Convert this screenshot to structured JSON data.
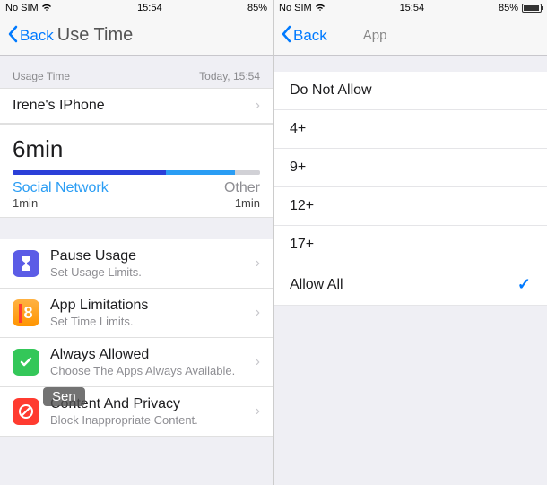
{
  "left": {
    "status": {
      "carrier": "No SIM",
      "time": "15:54",
      "battery": "85%"
    },
    "nav": {
      "back": "Back",
      "title": "Use Time"
    },
    "section": {
      "label": "Usage Time",
      "timestamp": "Today, 15:54"
    },
    "device": {
      "name": "Irene's IPhone"
    },
    "usage": {
      "total": "6min",
      "cat1_label": "Social Network",
      "cat2_label": "Other",
      "cat1_time": "1min",
      "cat2_time": "1min"
    },
    "overlay": "Sen",
    "menu": [
      {
        "title": "Pause Usage",
        "sub": "Set Usage Limits."
      },
      {
        "title": "App Limitations",
        "sub": "Set Time Limits."
      },
      {
        "title": "Always Allowed",
        "sub": "Choose The Apps Always Available."
      },
      {
        "title": "Content And Privacy",
        "sub": "Block Inappropriate Content."
      }
    ],
    "icon_num": "8"
  },
  "right": {
    "status": {
      "carrier": "No SIM",
      "time": "15:54",
      "battery": "85%"
    },
    "nav": {
      "back": "Back",
      "title": "App"
    },
    "options": [
      {
        "label": "Do Not Allow",
        "selected": false
      },
      {
        "label": "4+",
        "selected": false
      },
      {
        "label": "9+",
        "selected": false
      },
      {
        "label": "12+",
        "selected": false
      },
      {
        "label": "17+",
        "selected": false
      },
      {
        "label": "Allow All",
        "selected": true
      }
    ]
  }
}
